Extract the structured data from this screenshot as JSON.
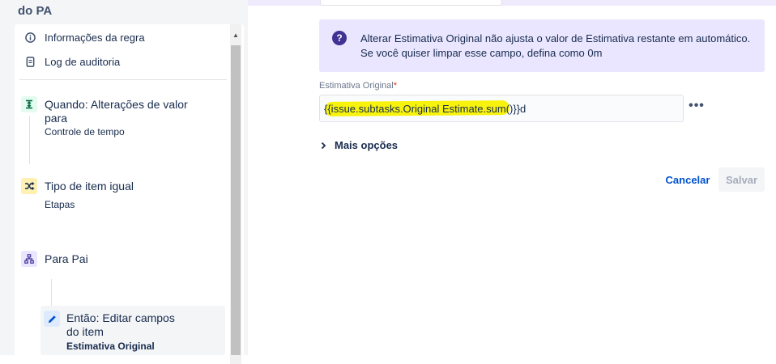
{
  "header": {
    "rule_title_fragment": "do PA"
  },
  "sidebar": {
    "menu": [
      {
        "label": "Informações da regra",
        "icon": "info-icon"
      },
      {
        "label": "Log de auditoria",
        "icon": "document-icon"
      }
    ],
    "steps": [
      {
        "title_lines": [
          "Quando: Alterações de valor",
          "para"
        ],
        "subtitle": "Controle de tempo",
        "icon": "trigger-icon",
        "icon_color": "#e3fcef"
      },
      {
        "title_lines": [
          "Tipo de item igual"
        ],
        "subtitle": "Etapas",
        "icon": "shuffle-icon",
        "icon_color": "#fff0b3"
      },
      {
        "title_lines": [
          "Para Pai"
        ],
        "subtitle": "",
        "icon": "hierarchy-icon",
        "icon_color": "#eae6ff"
      },
      {
        "title_lines": [
          "Então: Editar campos",
          "do item"
        ],
        "subtitle": "Estimativa Original",
        "icon": "pencil-icon",
        "icon_color": "#deebff"
      }
    ]
  },
  "info": {
    "icon": "question-icon",
    "line1": "Alterar Estimativa Original não ajusta o valor de Estimativa restante em automático.",
    "line2": "Se você quiser limpar esse campo, defina como 0m"
  },
  "field": {
    "label": "Estimativa Original",
    "required_mark": "*",
    "value": "{{issue.subtasks.Original Estimate.sum()}}d",
    "more_icon": "ellipsis-icon"
  },
  "more_options": {
    "label": "Mais opções",
    "icon": "chevron-right-icon"
  },
  "actions": {
    "cancel": "Cancelar",
    "save": "Salvar"
  },
  "colors": {
    "accent": "#0052cc",
    "info_bg": "#eae6ff",
    "highlight": "#f8f200"
  }
}
